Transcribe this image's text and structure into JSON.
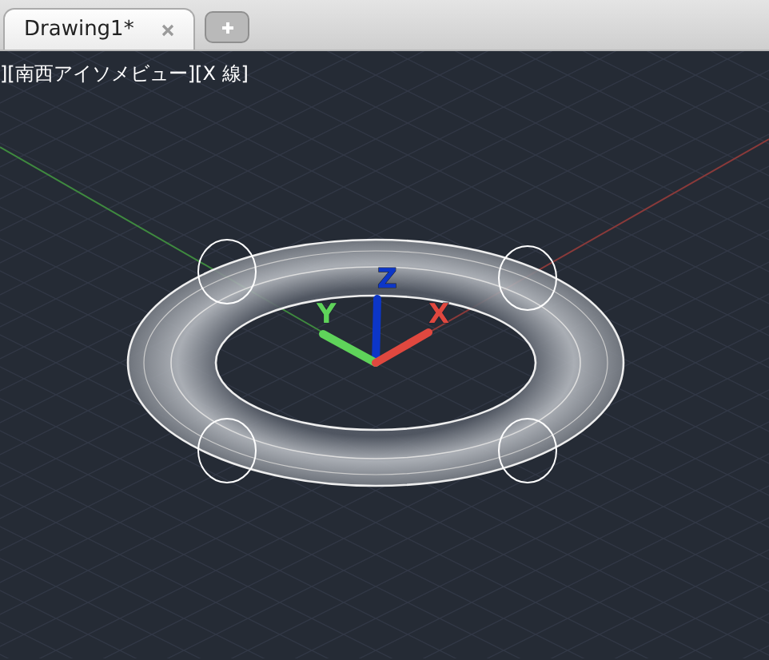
{
  "tabs": [
    {
      "label": "Drawing1*",
      "selected": true
    }
  ],
  "viewport": {
    "label": "][南西アイソメビュー][X 線]",
    "axes": [
      {
        "kind": "z",
        "label": "Z"
      },
      {
        "kind": "y",
        "label": "Y"
      },
      {
        "kind": "x",
        "label": "X"
      }
    ]
  }
}
